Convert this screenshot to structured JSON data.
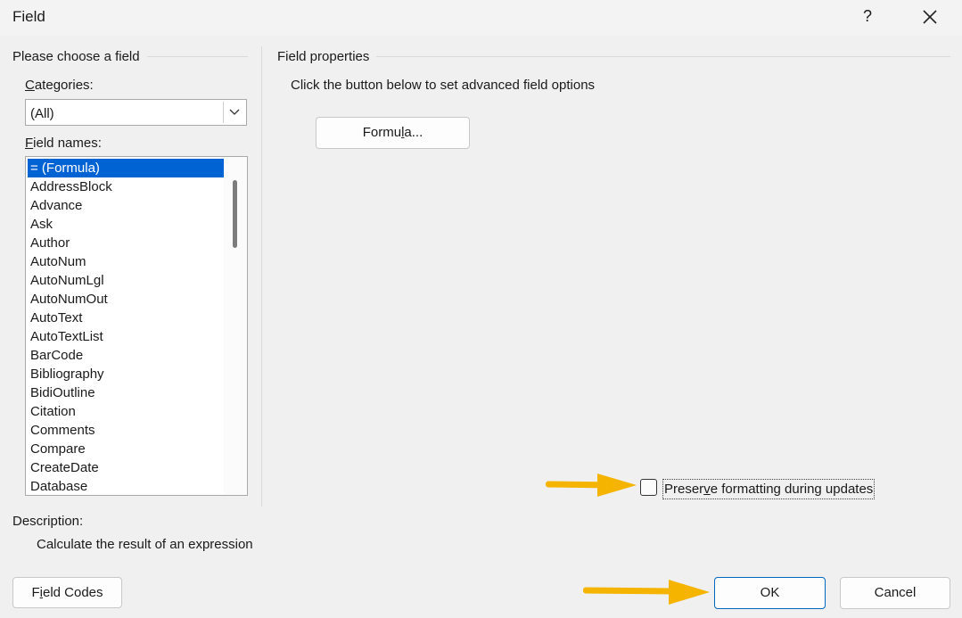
{
  "window": {
    "title": "Field",
    "help_label": "?"
  },
  "left_panel": {
    "group_title": "Please choose a field",
    "categories_label": {
      "mnemonic": "C",
      "rest": "ategories:"
    },
    "categories_value": "(All)",
    "field_names_label": {
      "mnemonic": "F",
      "rest": "ield names:"
    },
    "field_names": [
      "= (Formula)",
      "AddressBlock",
      "Advance",
      "Ask",
      "Author",
      "AutoNum",
      "AutoNumLgl",
      "AutoNumOut",
      "AutoText",
      "AutoTextList",
      "BarCode",
      "Bibliography",
      "BidiOutline",
      "Citation",
      "Comments",
      "Compare",
      "CreateDate",
      "Database"
    ],
    "selected_index": 0
  },
  "right_panel": {
    "group_title": "Field properties",
    "instruction": "Click the button below to set advanced field options",
    "formula_button": {
      "before": "Formu",
      "mnemonic": "l",
      "after": "a..."
    },
    "preserve_checkbox": {
      "before": "Preser",
      "mnemonic": "v",
      "after": "e formatting during updates",
      "checked": false
    }
  },
  "description": {
    "label": "Description:",
    "text": "Calculate the result of an expression"
  },
  "footer": {
    "field_codes_button": {
      "before": "F",
      "mnemonic": "i",
      "after": "eld Codes"
    },
    "ok_label": "OK",
    "cancel_label": "Cancel"
  },
  "colors": {
    "accent": "#0063d3",
    "annotation_arrow": "#f5b400"
  }
}
